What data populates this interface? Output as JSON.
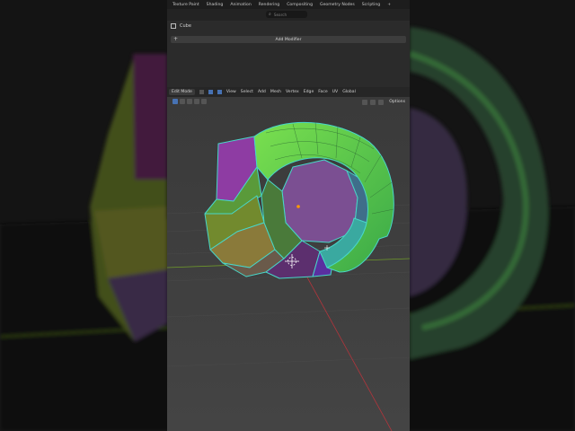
{
  "workspace_tabs": [
    "Texture Paint",
    "Shading",
    "Animation",
    "Rendering",
    "Compositing",
    "Geometry Nodes",
    "Scripting"
  ],
  "add_workspace_glyph": "+",
  "search": {
    "placeholder": "Search"
  },
  "properties": {
    "object_name": "Cube",
    "add_modifier_label": "Add Modifier",
    "plus_glyph": "+"
  },
  "viewport_header": {
    "mode": "Edit Mode",
    "menus": [
      "View",
      "Select",
      "Add",
      "Mesh",
      "Vertex",
      "Edge",
      "Face",
      "UV"
    ],
    "transform_orientation": "Global",
    "options_label": "Options"
  },
  "icons": [
    "search-icon",
    "cube-icon",
    "plus-icon",
    "move-icon",
    "select-mode-icon",
    "snap-icon",
    "cursor-icon"
  ],
  "colors": {
    "face_selected": "#8e3ca3",
    "mesh_edge": "#48d6c8",
    "mesh_green": "#5fd04a",
    "viewport_bg": "#3d3d3d",
    "x_axis": "#b0353c",
    "y_axis": "#6f9a2a"
  }
}
